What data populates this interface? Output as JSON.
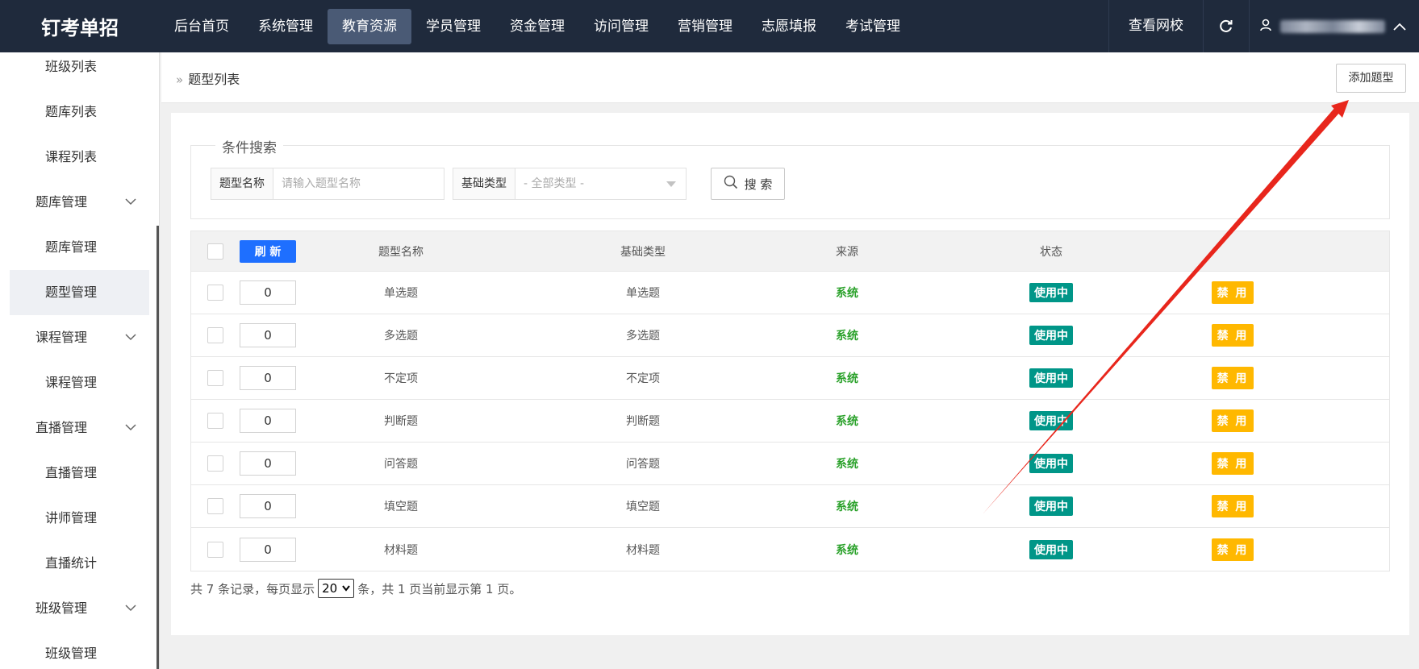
{
  "brand": "钉考单招",
  "nav": [
    "后台首页",
    "系统管理",
    "教育资源",
    "学员管理",
    "资金管理",
    "访问管理",
    "营销管理",
    "志愿填报",
    "考试管理"
  ],
  "nav_active_index": 2,
  "top_right": {
    "link": "查看网校",
    "refresh_icon": "refresh-icon",
    "user_icon": "user-icon"
  },
  "sidebar": [
    {
      "label": "班级列表",
      "type": "child"
    },
    {
      "label": "题库列表",
      "type": "child"
    },
    {
      "label": "课程列表",
      "type": "child"
    },
    {
      "label": "题库管理",
      "type": "group"
    },
    {
      "label": "题库管理",
      "type": "child"
    },
    {
      "label": "题型管理",
      "type": "child",
      "selected": true
    },
    {
      "label": "课程管理",
      "type": "group"
    },
    {
      "label": "课程管理",
      "type": "child"
    },
    {
      "label": "直播管理",
      "type": "group"
    },
    {
      "label": "直播管理",
      "type": "child"
    },
    {
      "label": "讲师管理",
      "type": "child"
    },
    {
      "label": "直播统计",
      "type": "child"
    },
    {
      "label": "班级管理",
      "type": "group"
    },
    {
      "label": "班级管理",
      "type": "child"
    }
  ],
  "page": {
    "breadcrumb": "题型列表",
    "add_button": "添加题型"
  },
  "search": {
    "legend": "条件搜索",
    "name_label": "题型名称",
    "name_placeholder": "请输入题型名称",
    "type_label": "基础类型",
    "type_value": "- 全部类型 -",
    "search_button": "搜 索"
  },
  "table": {
    "refresh_button": "刷 新",
    "headers": [
      "题型名称",
      "基础类型",
      "来源",
      "状态"
    ],
    "rows": [
      {
        "sort": "0",
        "name": "单选题",
        "base": "单选题",
        "source": "系统",
        "status": "使用中",
        "action": "禁 用"
      },
      {
        "sort": "0",
        "name": "多选题",
        "base": "多选题",
        "source": "系统",
        "status": "使用中",
        "action": "禁 用"
      },
      {
        "sort": "0",
        "name": "不定项",
        "base": "不定项",
        "source": "系统",
        "status": "使用中",
        "action": "禁 用"
      },
      {
        "sort": "0",
        "name": "判断题",
        "base": "判断题",
        "source": "系统",
        "status": "使用中",
        "action": "禁 用"
      },
      {
        "sort": "0",
        "name": "问答题",
        "base": "问答题",
        "source": "系统",
        "status": "使用中",
        "action": "禁 用"
      },
      {
        "sort": "0",
        "name": "填空题",
        "base": "填空题",
        "source": "系统",
        "status": "使用中",
        "action": "禁 用"
      },
      {
        "sort": "0",
        "name": "材料题",
        "base": "材料题",
        "source": "系统",
        "status": "使用中",
        "action": "禁 用"
      }
    ]
  },
  "pagination": {
    "prefix": "共 7 条记录，每页显示",
    "page_size": "20",
    "suffix": "条，共 1 页当前显示第 1 页。"
  },
  "colors": {
    "topbar": "#1f2a3c",
    "refresh": "#1e6fff",
    "status_green": "#009688",
    "action_orange": "#ffb800",
    "source_green": "#2aa12a",
    "annotation_arrow": "#e8261c"
  }
}
